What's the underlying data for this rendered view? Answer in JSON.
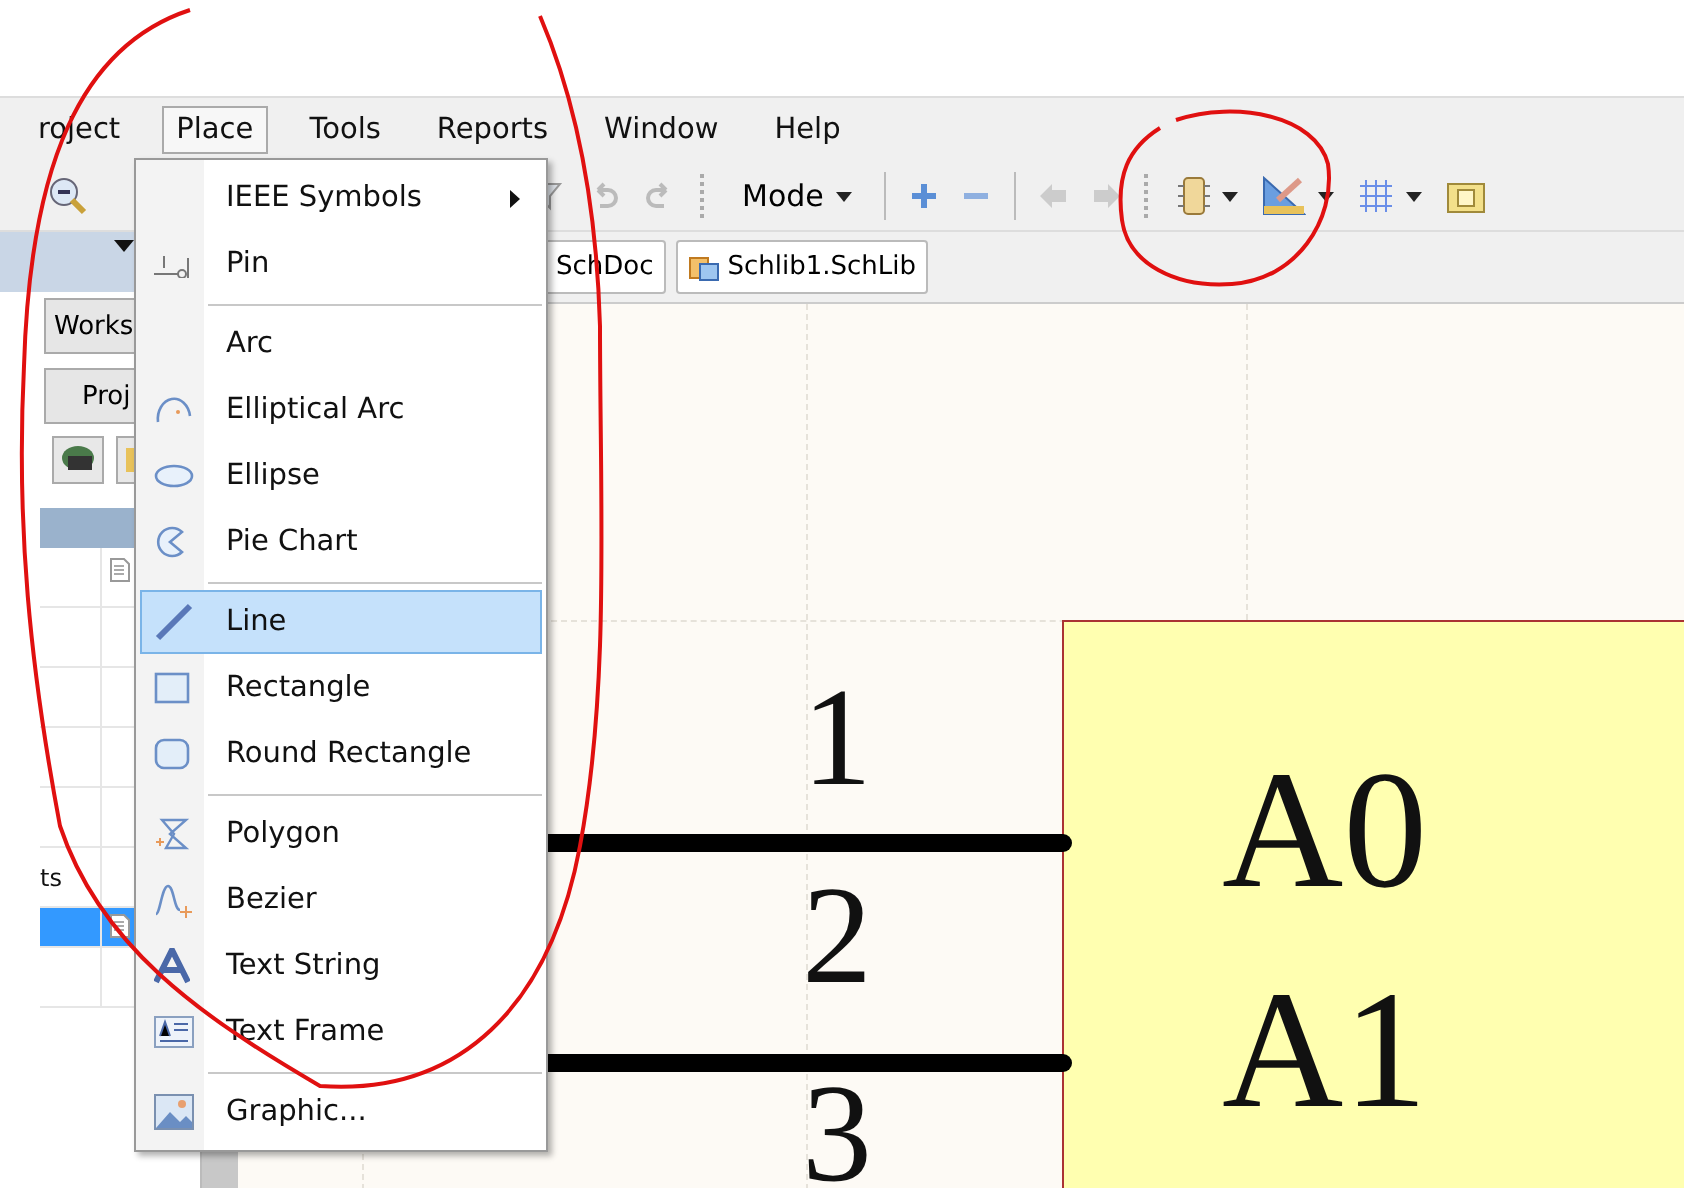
{
  "menu_bar": [
    {
      "label": "roject",
      "selected": false
    },
    {
      "label": "Place",
      "selected": true
    },
    {
      "label": "Tools",
      "selected": false
    },
    {
      "label": "Reports",
      "selected": false
    },
    {
      "label": "Window",
      "selected": false
    },
    {
      "label": "Help",
      "selected": false
    }
  ],
  "toolbar": {
    "mode_button": {
      "label": "Mode"
    }
  },
  "left_panel": {
    "buttons": [
      {
        "label": "Works"
      },
      {
        "label": "Proj"
      }
    ],
    "rows": [
      {
        "selected": false
      },
      {
        "selected": false
      },
      {
        "selected": false
      },
      {
        "selected": false
      },
      {
        "selected": false
      },
      {
        "label": "ts",
        "selected": false
      },
      {
        "selected": true
      },
      {
        "selected": false
      }
    ]
  },
  "doc_tabs": [
    {
      "label": "SchDoc",
      "kind": "plain"
    },
    {
      "label": "Schlib1.SchLib",
      "kind": "library"
    }
  ],
  "place_menu": {
    "groups": [
      [
        {
          "label": "IEEE Symbols",
          "kind": "none",
          "submenu": true,
          "selected": false
        },
        {
          "label": "Pin",
          "kind": "pin",
          "submenu": false,
          "selected": false
        }
      ],
      [
        {
          "label": "Arc",
          "kind": "none",
          "submenu": false,
          "selected": false
        },
        {
          "label": "Elliptical Arc",
          "kind": "elliptical_arc",
          "submenu": false,
          "selected": false
        },
        {
          "label": "Ellipse",
          "kind": "ellipse",
          "submenu": false,
          "selected": false
        },
        {
          "label": "Pie Chart",
          "kind": "pie",
          "submenu": false,
          "selected": false
        }
      ],
      [
        {
          "label": "Line",
          "kind": "line",
          "submenu": false,
          "selected": true
        },
        {
          "label": "Rectangle",
          "kind": "rectangle",
          "submenu": false,
          "selected": false
        },
        {
          "label": "Round Rectangle",
          "kind": "round_rectangle",
          "submenu": false,
          "selected": false
        }
      ],
      [
        {
          "label": "Polygon",
          "kind": "polygon",
          "submenu": false,
          "selected": false
        },
        {
          "label": "Bezier",
          "kind": "bezier",
          "submenu": false,
          "selected": false
        },
        {
          "label": "Text String",
          "kind": "text_string",
          "submenu": false,
          "selected": false
        },
        {
          "label": "Text Frame",
          "kind": "text_frame",
          "submenu": false,
          "selected": false
        }
      ],
      [
        {
          "label": "Graphic...",
          "kind": "graphic",
          "submenu": false,
          "selected": false
        }
      ]
    ]
  },
  "component": {
    "pins": [
      {
        "number": "1",
        "name": "A0"
      },
      {
        "number": "2",
        "name": "A1"
      },
      {
        "number": "3"
      }
    ]
  }
}
